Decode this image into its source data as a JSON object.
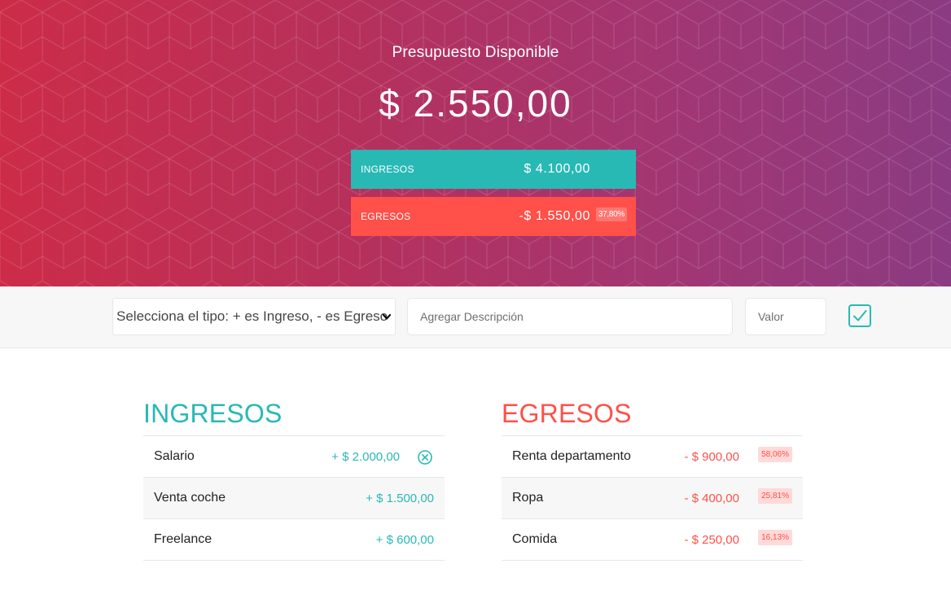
{
  "header": {
    "title": "Presupuesto Disponible",
    "budget_value": "$ 2.550,00",
    "income": {
      "label": "INGRESOS",
      "value": "$ 4.100,00"
    },
    "expenses": {
      "label": "EGRESOS",
      "value": "-$ 1.550,00",
      "percentage": "37,80%"
    }
  },
  "add_bar": {
    "type_select_value": "Selecciona el tipo: + es Ingreso, - es Egreso",
    "description_placeholder": "Agregar Descripción",
    "value_placeholder": "Valor",
    "submit_icon": "check-square-icon"
  },
  "income_list": {
    "title": "INGRESOS",
    "items": [
      {
        "description": "Salario",
        "value": "+ $ 2.000,00"
      },
      {
        "description": "Venta coche",
        "value": "+ $ 1.500,00"
      },
      {
        "description": "Freelance",
        "value": "+ $ 600,00"
      }
    ]
  },
  "expense_list": {
    "title": "EGRESOS",
    "items": [
      {
        "description": "Renta departamento",
        "value": "- $ 900,00",
        "percentage": "58,06%"
      },
      {
        "description": "Ropa",
        "value": "- $ 400,00",
        "percentage": "25,81%"
      },
      {
        "description": "Comida",
        "value": "- $ 250,00",
        "percentage": "16,13%"
      }
    ]
  },
  "colors": {
    "income": "#28b9b5",
    "expense": "#ff5049",
    "header_start": "#cc2c48",
    "header_end": "#8b3b82"
  }
}
